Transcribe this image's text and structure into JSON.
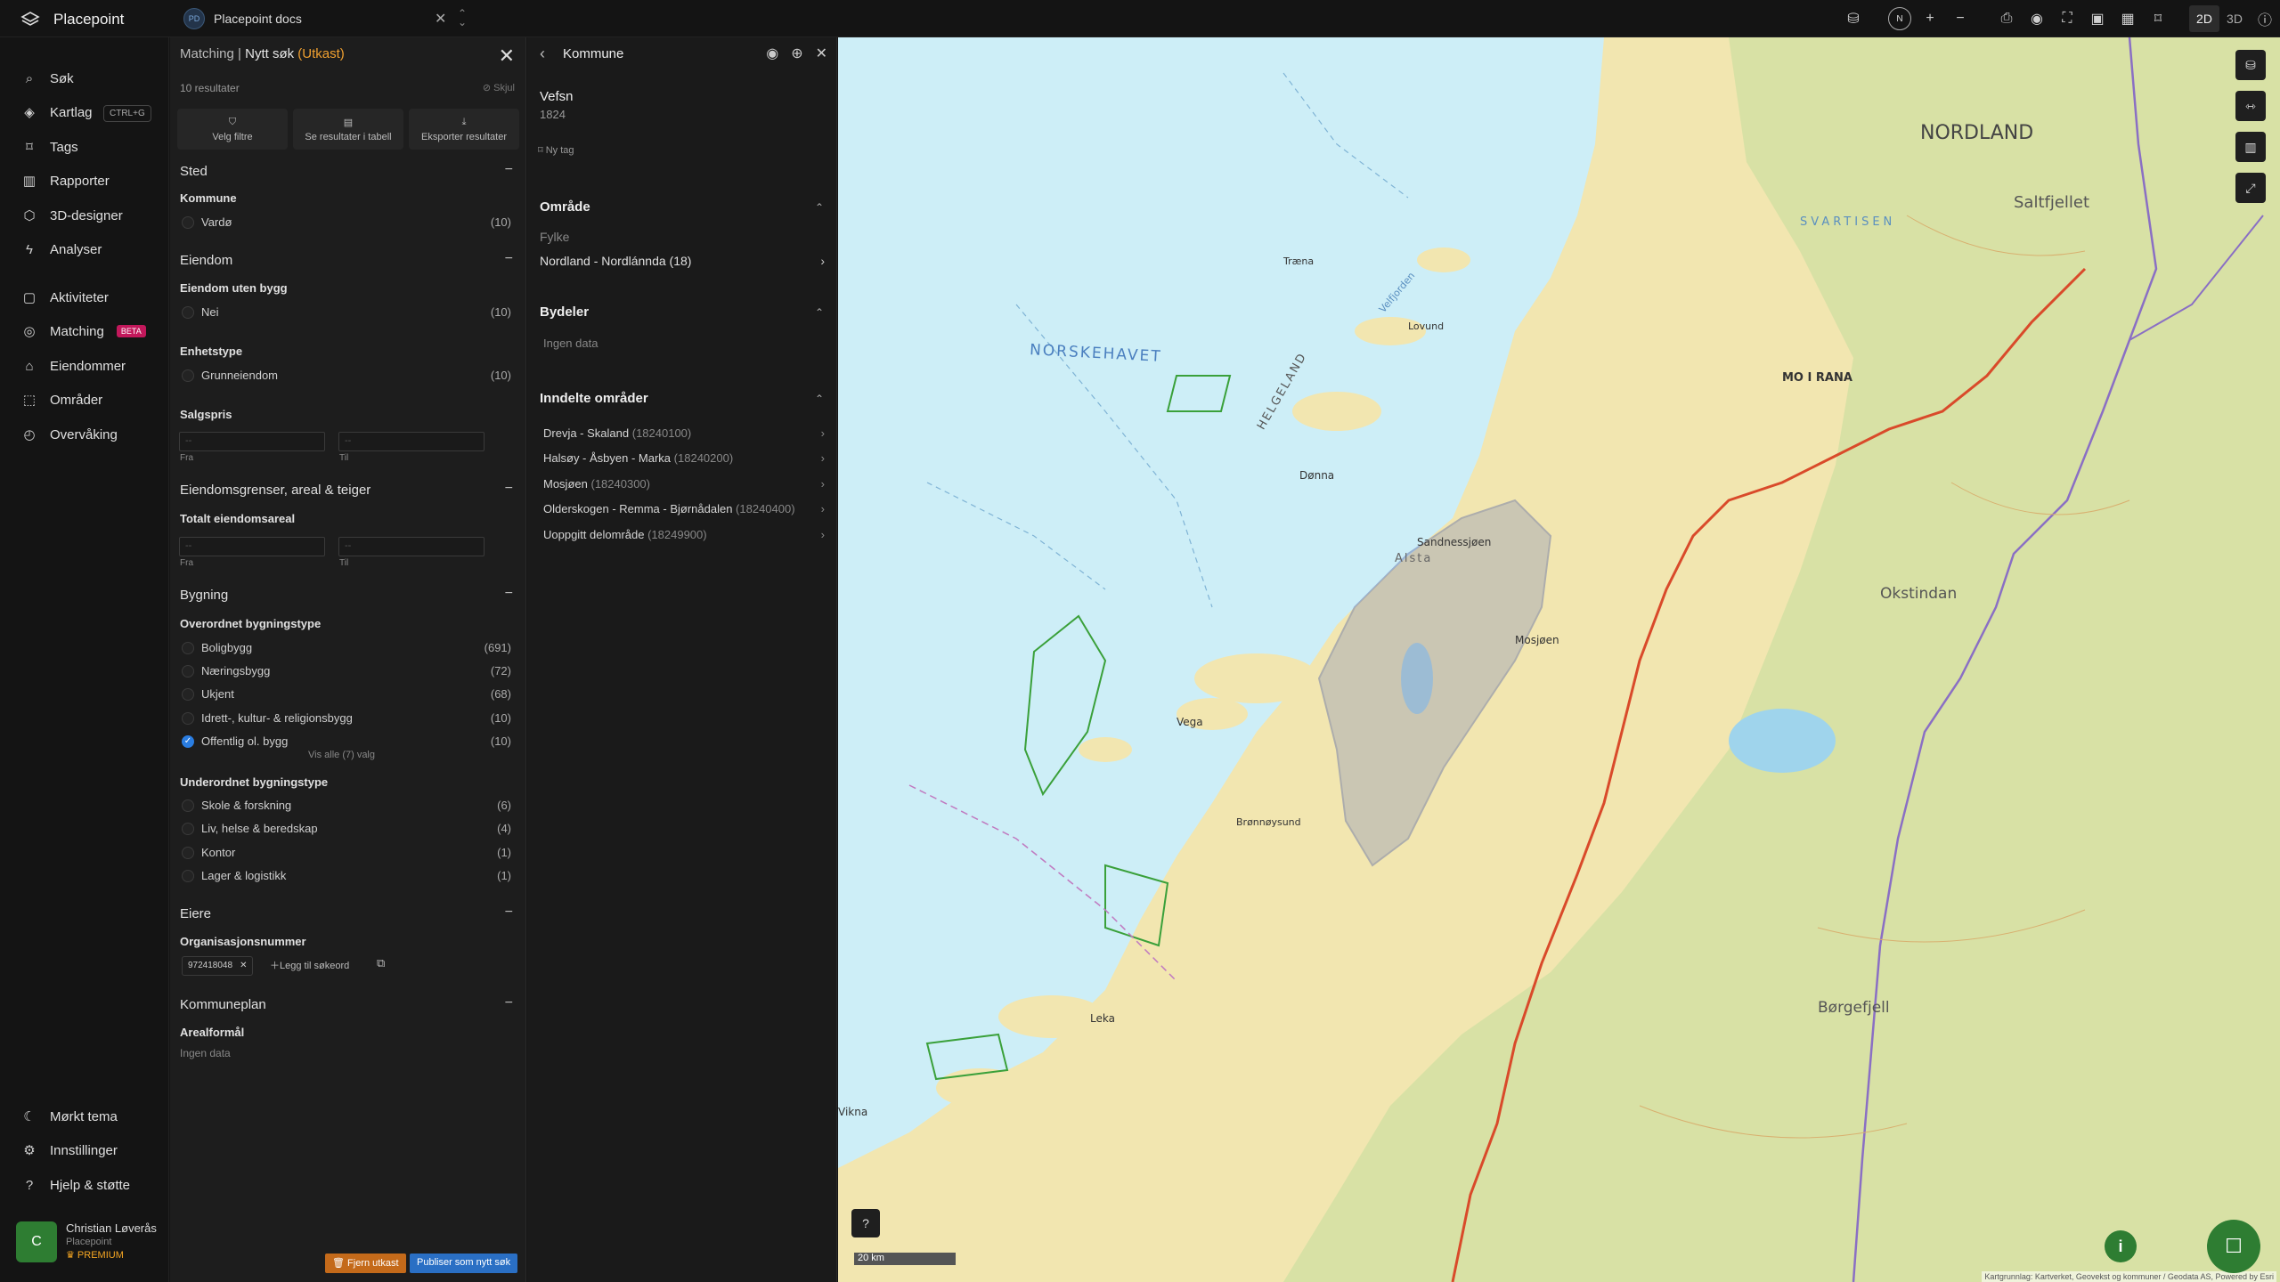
{
  "app": {
    "name": "Placepoint"
  },
  "project": {
    "badge": "PD",
    "name": "Placepoint docs"
  },
  "topbar": {
    "compass": "N",
    "view_2d": "2D",
    "view_3d": "3D"
  },
  "nav": {
    "search": "Søk",
    "search_kbd": "CTRL+G",
    "items": [
      "Kartlag",
      "Tags",
      "Rapporter",
      "3D-designer",
      "Analyser"
    ],
    "items2": [
      "Aktiviteter",
      "Matching",
      "Eiendommer",
      "Områder",
      "Overvåking"
    ],
    "beta": "BETA",
    "bottom": [
      "Mørkt tema",
      "Innstillinger",
      "Hjelp & støtte"
    ],
    "user": {
      "initial": "C",
      "name": "Christian Løverås",
      "org": "Placepoint",
      "plan": "PREMIUM"
    }
  },
  "matching": {
    "crumb": "Matching",
    "sep": "|",
    "title": "Nytt søk",
    "draft": "(Utkast)",
    "results": "10 resultater",
    "hide": "Skjul",
    "buttons": [
      "Velg filtre",
      "Se resultater i tabell",
      "Eksporter resultater"
    ],
    "sted": {
      "title": "Sted",
      "kommune": "Kommune",
      "opt": "Vardø",
      "cnt": "(10)"
    },
    "eiendom": {
      "title": "Eiendom",
      "uten_bygg": "Eiendom uten bygg",
      "nei": "Nei",
      "nei_cnt": "(10)",
      "enhetstype": "Enhetstype",
      "grunn": "Grunneiendom",
      "grunn_cnt": "(10)",
      "salgspris": "Salgspris",
      "fra": "Fra",
      "til": "Til",
      "ph": "--"
    },
    "grenser": {
      "title": "Eiendomsgrenser, areal & teiger",
      "totalt": "Totalt eiendomsareal",
      "fra": "Fra",
      "til": "Til",
      "ph": "--"
    },
    "bygning": {
      "title": "Bygning",
      "over": "Overordnet bygningstype",
      "over_items": [
        {
          "label": "Boligbygg",
          "cnt": "(691)"
        },
        {
          "label": "Næringsbygg",
          "cnt": "(72)"
        },
        {
          "label": "Ukjent",
          "cnt": "(68)"
        },
        {
          "label": "Idrett-, kultur- & religionsbygg",
          "cnt": "(10)"
        },
        {
          "label": "Offentlig ol. bygg",
          "cnt": "(10)"
        }
      ],
      "vis_alle": "Vis alle (7) valg",
      "under": "Underordnet bygningstype",
      "under_items": [
        {
          "label": "Skole & forskning",
          "cnt": "(6)"
        },
        {
          "label": "Liv, helse & beredskap",
          "cnt": "(4)"
        },
        {
          "label": "Kontor",
          "cnt": "(1)"
        },
        {
          "label": "Lager & logistikk",
          "cnt": "(1)"
        }
      ]
    },
    "eiere": {
      "title": "Eiere",
      "org": "Organisasjonsnummer",
      "chip": "972418048",
      "add": "Legg til søkeord"
    },
    "kommuneplan": {
      "title": "Kommuneplan",
      "areal": "Arealformål",
      "none": "Ingen data"
    },
    "remove": "Fjern utkast",
    "publish": "Publiser som nytt søk"
  },
  "kommune": {
    "title": "Kommune",
    "name": "Vefsn",
    "code": "1824",
    "tag": "Ny tag",
    "omrade": "Område",
    "fylke_label": "Fylke",
    "fylke": "Nordland - Nordlánnda",
    "fylke_code": "(18)",
    "bydeler": "Bydeler",
    "bydeler_none": "Ingen data",
    "inndelte": "Inndelte områder",
    "areas": [
      {
        "name": "Drevja - Skaland",
        "code": "(18240100)"
      },
      {
        "name": "Halsøy - Åsbyen - Marka",
        "code": "(18240200)"
      },
      {
        "name": "Mosjøen",
        "code": "(18240300)"
      },
      {
        "name": "Olderskogen - Remma - Bjørnådalen",
        "code": "(18240400)"
      },
      {
        "name": "Uoppgitt delområde",
        "code": "(18249900)"
      }
    ]
  },
  "map": {
    "labels": {
      "sea": "NORSKEHAVET",
      "helgeland": "HELGELAND",
      "nordland": "NORDLAND",
      "svartisen": "SVARTISEN",
      "mo": "MO I RANA",
      "saltfjellet": "Saltfjellet",
      "okstindan": "Okstindan",
      "borgefjell": "Børgefjell",
      "mosjoen": "Mosjøen",
      "vega": "Vega",
      "bronnoysund": "Brønnøysund",
      "sandnessjoen": "Sandnessjøen",
      "alsta": "Alsta",
      "traena": "Træna",
      "lovund": "Lovund",
      "donna": "Dønna",
      "vikna": "Vikna",
      "leka": "Leka",
      "velfjord": "Velfjorden"
    },
    "scale": "20 km",
    "attribution": "Kartgrunnlag: Kartverket, Geovekst og kommuner / Geodata AS, Powered by Esri",
    "colors": {
      "water": "#cdeef7",
      "land": "#f2e6b0",
      "forest": "#c9dfa0",
      "border": "#8a6fc4",
      "road": "#d94a2a"
    }
  }
}
